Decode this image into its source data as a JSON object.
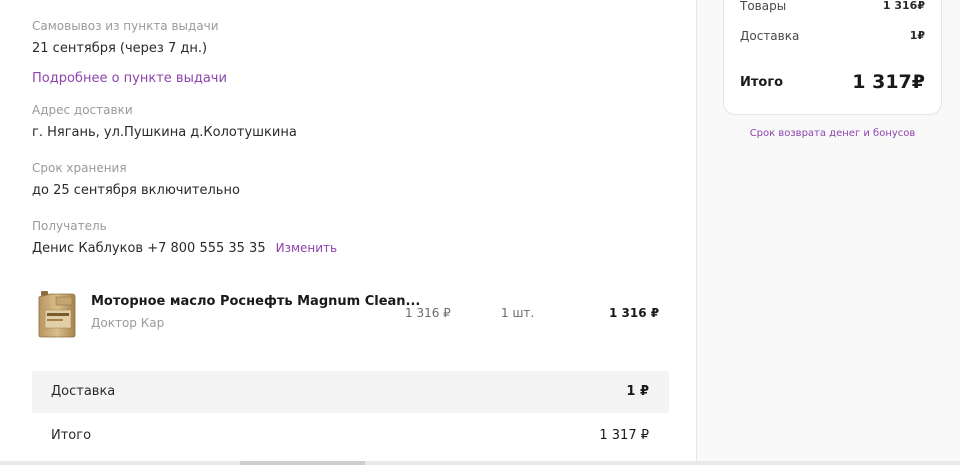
{
  "pickup": {
    "label": "Самовывоз из пункта выдачи",
    "date": "21 сентября (через 7 дн.)",
    "details_link": "Подробнее о пункте выдачи"
  },
  "address": {
    "label": "Адрес доставки",
    "value": "г. Нягань, ул.Пушкина д.Колотушкина"
  },
  "storage": {
    "label": "Срок хранения",
    "value": "до 25 сентября включительно"
  },
  "recipient": {
    "label": "Получатель",
    "value": "Денис Каблуков +7 800 555 35 35",
    "change_link": "Изменить"
  },
  "product": {
    "name": "Моторное масло Роснефть Magnum Clean...",
    "seller": "Доктор Кар",
    "price": "1 316 ₽",
    "quantity": "1 шт.",
    "total": "1 316 ₽"
  },
  "order_delivery": {
    "label": "Доставка",
    "value": "1 ₽"
  },
  "order_total": {
    "label": "Итого",
    "value": "1 317 ₽"
  },
  "summary": {
    "goods_label": "Товары",
    "goods_value": "1 316₽",
    "delivery_label": "Доставка",
    "delivery_value": "1₽",
    "total_label": "Итого",
    "total_value": "1 317₽"
  },
  "refund_link": "Срок возврата денег и бонусов",
  "colors": {
    "accent": "#8e44ad",
    "muted": "#9a9a9a",
    "row_bg": "#f4f4f4"
  }
}
